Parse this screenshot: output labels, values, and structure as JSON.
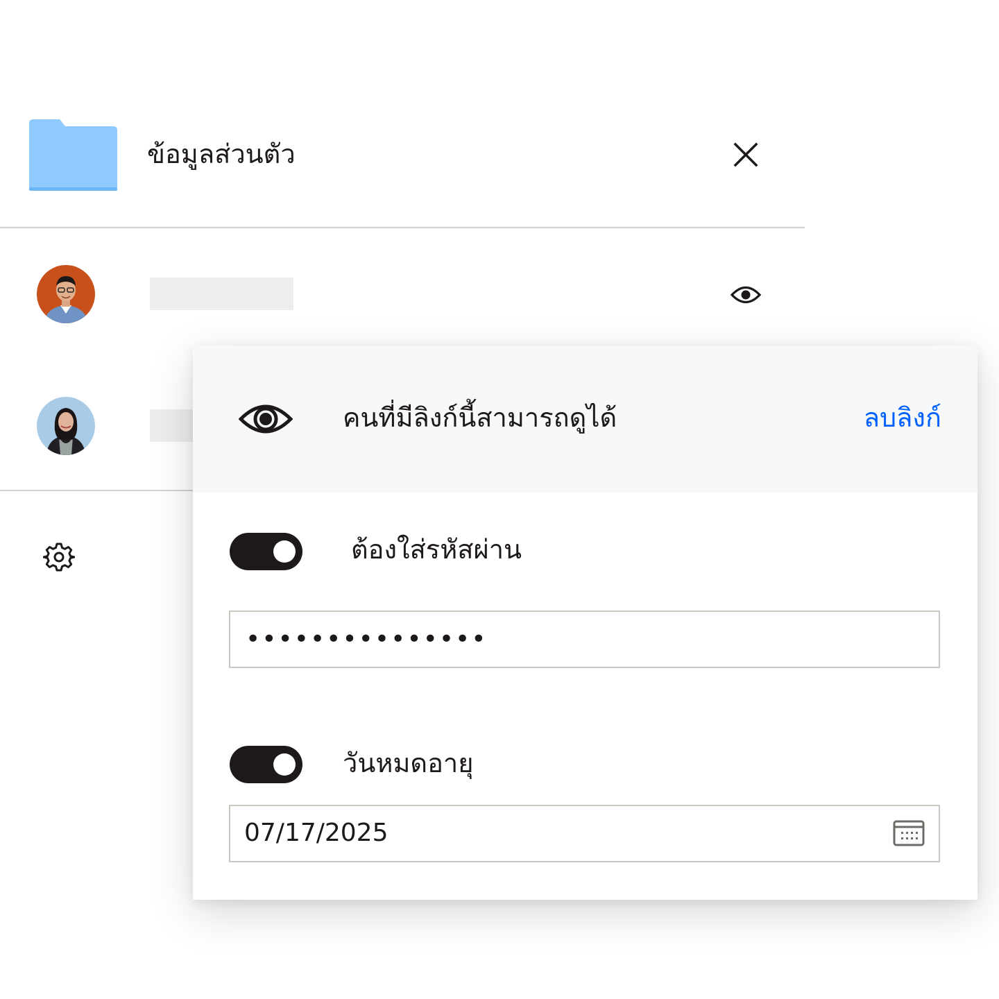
{
  "folder": {
    "title": "ข้อมูลส่วนตัว",
    "icon": "folder-icon",
    "color": "#8fcaff"
  },
  "header": {
    "close_icon": "close-icon"
  },
  "members": [
    {
      "avatar": "avatar-man",
      "permission_icon": "eye-icon"
    },
    {
      "avatar": "avatar-woman"
    }
  ],
  "settings": {
    "icon": "gear-icon"
  },
  "link_popover": {
    "permission_text": "คนที่มีลิงก์นี้สามารถดูได้",
    "remove_link_label": "ลบลิงก์",
    "password": {
      "label": "ต้องใส่รหัสผ่าน",
      "enabled": true,
      "value": "•••••••••••••••"
    },
    "expiration": {
      "label": "วันหมดอายุ",
      "enabled": true,
      "value": "07/17/2025",
      "icon": "calendar-icon"
    }
  },
  "colors": {
    "accent": "#0061fe",
    "toggle_on": "#1e1919",
    "header_bg": "#f7f8fa"
  }
}
